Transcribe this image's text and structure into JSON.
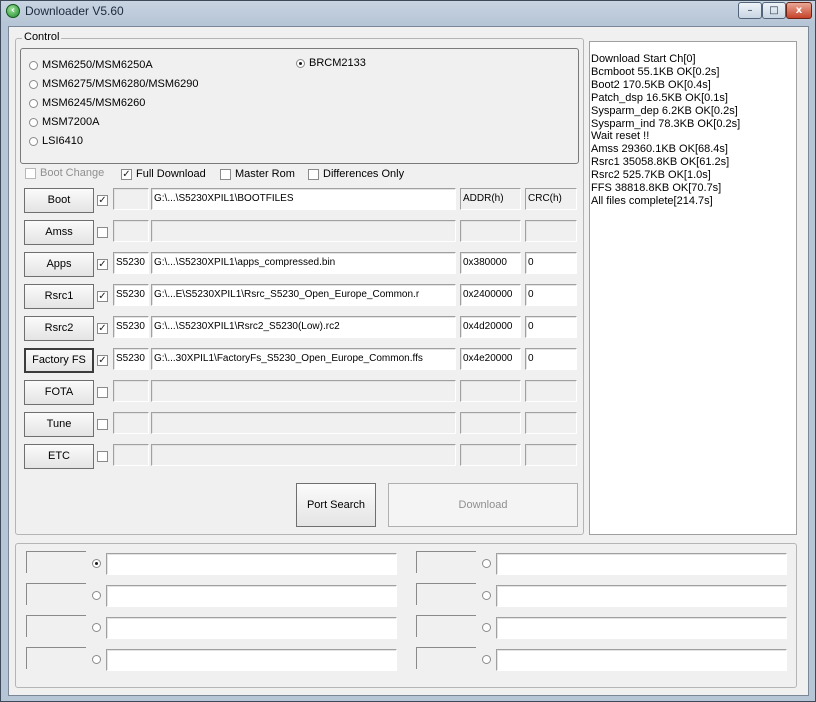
{
  "window": {
    "title": "Downloader V5.60",
    "icon": "green-arrow-app-icon",
    "caption_buttons": {
      "minimize": "–",
      "maximize": "□",
      "close": "x"
    }
  },
  "control": {
    "group_label": "Control",
    "platforms": [
      {
        "label": "MSM6250/MSM6250A",
        "checked": false
      },
      {
        "label": "MSM6275/MSM6280/MSM6290",
        "checked": false
      },
      {
        "label": "MSM6245/MSM6260",
        "checked": false
      },
      {
        "label": "MSM7200A",
        "checked": false
      },
      {
        "label": "LSI6410",
        "checked": false
      },
      {
        "label": "BRCM2133",
        "checked": true
      }
    ],
    "options": {
      "boot_change": {
        "label": "Boot Change",
        "checked": false,
        "enabled": false
      },
      "full_download": {
        "label": "Full Download",
        "checked": true
      },
      "master_rom": {
        "label": "Master Rom",
        "checked": false
      },
      "differences_only": {
        "label": "Differences Only",
        "checked": false
      }
    },
    "headers": {
      "addr": "ADDR(h)",
      "crc": "CRC(h)"
    },
    "rows": [
      {
        "button": "Boot",
        "checked": true,
        "name": "",
        "path": "G:\\...\\S5230XPIL1\\BOOTFILES",
        "addr": "",
        "crc": ""
      },
      {
        "button": "Amss",
        "checked": false,
        "name": "",
        "path": "",
        "addr": "",
        "crc": ""
      },
      {
        "button": "Apps",
        "checked": true,
        "name": "S5230",
        "path": "G:\\...\\S5230XPIL1\\apps_compressed.bin",
        "addr": "0x380000",
        "crc": "0"
      },
      {
        "button": "Rsrc1",
        "checked": true,
        "name": "S5230",
        "path": "G:\\...E\\S5230XPIL1\\Rsrc_S5230_Open_Europe_Common.r",
        "addr": "0x2400000",
        "crc": "0"
      },
      {
        "button": "Rsrc2",
        "checked": true,
        "name": "S5230",
        "path": "G:\\...\\S5230XPIL1\\Rsrc2_S5230(Low).rc2",
        "addr": "0x4d20000",
        "crc": "0"
      },
      {
        "button": "Factory FS",
        "checked": true,
        "name": "S5230",
        "path": "G:\\...30XPIL1\\FactoryFs_S5230_Open_Europe_Common.ffs",
        "addr": "0x4e20000",
        "crc": "0"
      },
      {
        "button": "FOTA",
        "checked": false,
        "name": "",
        "path": "",
        "addr": "",
        "crc": ""
      },
      {
        "button": "Tune",
        "checked": false,
        "name": "",
        "path": "",
        "addr": "",
        "crc": ""
      },
      {
        "button": "ETC",
        "checked": false,
        "name": "",
        "path": "",
        "addr": "",
        "crc": ""
      }
    ],
    "port_search": "Port Search",
    "download": "Download",
    "download_enabled": false
  },
  "log": [
    "Download Start Ch[0]",
    "Bcmboot 55.1KB OK[0.2s]",
    "Boot2 170.5KB OK[0.4s]",
    "Patch_dsp 16.5KB OK[0.1s]",
    "Sysparm_dep 6.2KB OK[0.2s]",
    "Sysparm_ind 78.3KB OK[0.2s]",
    "Wait reset !!",
    "Amss 29360.1KB OK[68.4s]",
    "Rsrc1 35058.8KB OK[61.2s]",
    "Rsrc2 525.7KB OK[1.0s]",
    "FFS 38818.8KB OK[70.7s]",
    "All files complete[214.7s]"
  ],
  "ports": [
    {
      "selected": true,
      "value": ""
    },
    {
      "selected": false,
      "value": ""
    },
    {
      "selected": false,
      "value": ""
    },
    {
      "selected": false,
      "value": ""
    },
    {
      "selected": false,
      "value": ""
    },
    {
      "selected": false,
      "value": ""
    },
    {
      "selected": false,
      "value": ""
    },
    {
      "selected": false,
      "value": ""
    }
  ]
}
